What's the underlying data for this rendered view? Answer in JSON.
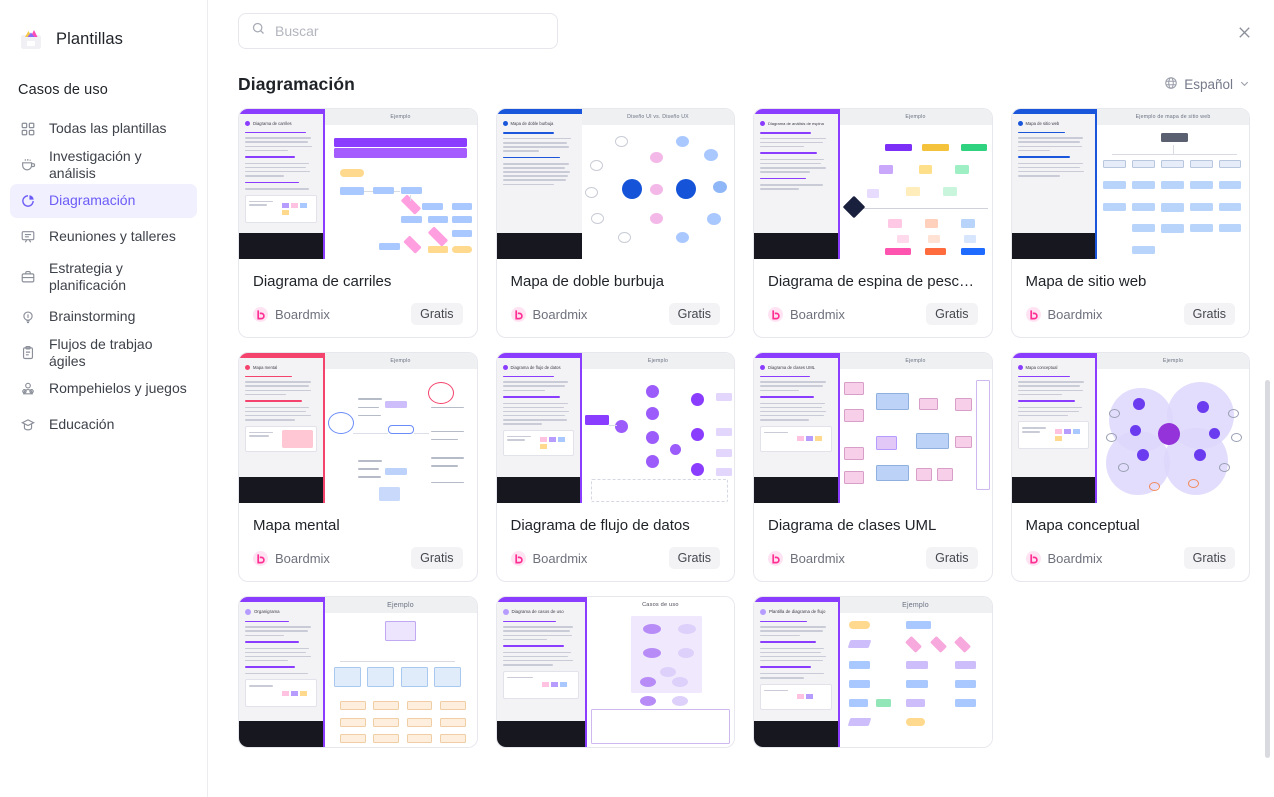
{
  "brand": {
    "title": "Plantillas",
    "logo_icon": "templates-logo-icon"
  },
  "sidebar": {
    "section_label": "Casos de uso",
    "items": [
      {
        "label": "Todas las plantillas",
        "icon": "grid-icon",
        "active": false
      },
      {
        "label": "Investigación y análisis",
        "icon": "magnifier-cup-icon",
        "active": false
      },
      {
        "label": "Diagramación",
        "icon": "pie-chart-icon",
        "active": true
      },
      {
        "label": "Reuniones y talleres",
        "icon": "presentation-icon",
        "active": false
      },
      {
        "label": "Estrategia y planificación",
        "icon": "briefcase-icon",
        "active": false
      },
      {
        "label": "Brainstorming",
        "icon": "lightbulb-icon",
        "active": false
      },
      {
        "label": "Flujos de trabjao ágiles",
        "icon": "clipboard-icon",
        "active": false
      },
      {
        "label": "Rompehielos y juegos",
        "icon": "people-icon",
        "active": false
      },
      {
        "label": "Educación",
        "icon": "graduation-cap-icon",
        "active": false
      }
    ]
  },
  "search": {
    "placeholder": "Buscar",
    "value": "",
    "icon": "search-icon"
  },
  "close_button": {
    "icon": "close-icon"
  },
  "section": {
    "title": "Diagramación",
    "language": {
      "label": "Español",
      "globe_icon": "globe-icon",
      "chevron_icon": "chevron-down-icon"
    }
  },
  "colors": {
    "accent": "#6b5cf6",
    "accent_bg": "#f1f0fe",
    "brand_pink": "#ff2e93",
    "badge_bg": "#f3f3f5",
    "border": "#e7e7ee"
  },
  "cards": [
    {
      "title": "Diagrama de carriles",
      "author": "Boardmix",
      "price": "Gratis",
      "board_title": "Ejemplo",
      "accent": "#8b3dff",
      "theme": "swimlane"
    },
    {
      "title": "Mapa de doble burbuja",
      "author": "Boardmix",
      "price": "Gratis",
      "board_title": "Diseño UI vs. Diseño UX",
      "accent": "#1a56db",
      "theme": "double-bubble"
    },
    {
      "title": "Diagrama de espina de pesca...",
      "author": "Boardmix",
      "price": "Gratis",
      "board_title": "Ejemplo",
      "accent": "#8b3dff",
      "theme": "fishbone"
    },
    {
      "title": "Mapa de sitio web",
      "author": "Boardmix",
      "price": "Gratis",
      "board_title": "Ejemplo de mapa de sitio web",
      "accent": "#1a56db",
      "theme": "sitemap"
    },
    {
      "title": "Mapa mental",
      "author": "Boardmix",
      "price": "Gratis",
      "board_title": "Ejemplo",
      "accent": "#f4436c",
      "theme": "mindmap"
    },
    {
      "title": "Diagrama de flujo de datos",
      "author": "Boardmix",
      "price": "Gratis",
      "board_title": "Ejemplo",
      "accent": "#8b3dff",
      "theme": "dataflow"
    },
    {
      "title": "Diagrama de clases UML",
      "author": "Boardmix",
      "price": "Gratis",
      "board_title": "Ejemplo",
      "accent": "#8b3dff",
      "theme": "uml"
    },
    {
      "title": "Mapa conceptual",
      "author": "Boardmix",
      "price": "Gratis",
      "board_title": "Ejemplo",
      "accent": "#8b3dff",
      "theme": "concept"
    },
    {
      "title": "",
      "author": "",
      "price": "",
      "board_title": "Ejemplo",
      "accent": "#8b3dff",
      "theme": "orgchart"
    },
    {
      "title": "",
      "author": "",
      "price": "",
      "board_title": "Casos de uso",
      "accent": "#8b3dff",
      "theme": "usecase"
    },
    {
      "title": "",
      "author": "",
      "price": "",
      "board_title": "Ejemplo",
      "accent": "#8b3dff",
      "theme": "flowchart"
    }
  ],
  "scrollbar": {
    "name": "vertical-scrollbar"
  }
}
